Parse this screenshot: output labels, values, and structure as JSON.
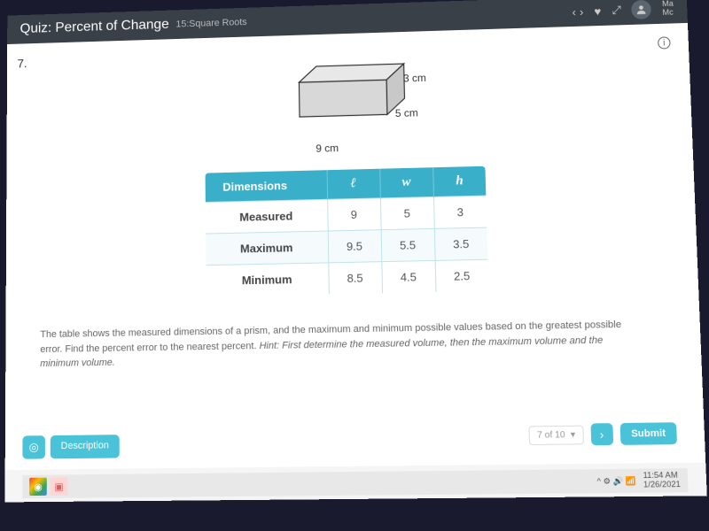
{
  "header": {
    "title_prefix": "Quiz:",
    "title": "Percent of Change",
    "subtitle": "15:Square Roots",
    "user_initial": "M",
    "user_label1": "Ma",
    "user_label2": "Mc"
  },
  "question": {
    "number": "7."
  },
  "prism": {
    "h_label": "3 cm",
    "w_label": "5 cm",
    "l_label": "9 cm"
  },
  "table": {
    "headers": {
      "dim": "Dimensions",
      "l": "ℓ",
      "w": "w",
      "h": "h"
    },
    "rows": [
      {
        "label": "Measured",
        "l": "9",
        "w": "5",
        "h": "3"
      },
      {
        "label": "Maximum",
        "l": "9.5",
        "w": "5.5",
        "h": "3.5"
      },
      {
        "label": "Minimum",
        "l": "8.5",
        "w": "4.5",
        "h": "2.5"
      }
    ]
  },
  "instruction": {
    "text": "The table shows the measured dimensions of a prism, and the maximum and minimum possible values based on the greatest possible error. Find the percent error to the nearest percent.",
    "hint_label": "Hint:",
    "hint_text": "First determine the measured volume, then the maximum volume and the minimum volume."
  },
  "controls": {
    "pager": "7 of 10",
    "next": "›",
    "submit": "Submit",
    "description": "Description",
    "desc_icon": "◎"
  },
  "taskbar": {
    "time": "11:54 AM",
    "date": "1/26/2021",
    "tray": "^ ⚙ 🔊 📶"
  }
}
